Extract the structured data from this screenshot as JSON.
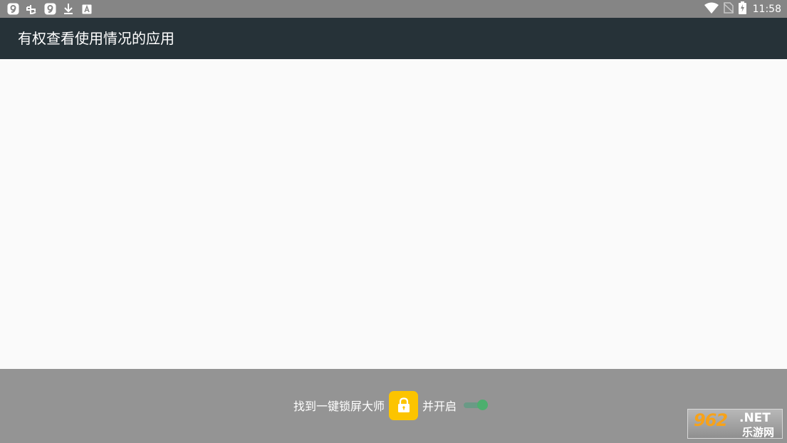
{
  "status_bar": {
    "left_icons": [
      "app-notification-icon",
      "bug-icon",
      "app-notification-icon",
      "download-icon",
      "text-a-icon"
    ],
    "right_icons": [
      "wifi-icon",
      "no-sim-icon",
      "battery-charging-icon"
    ],
    "time": "11:58"
  },
  "app_bar": {
    "title": "有权查看使用情况的应用"
  },
  "guide": {
    "text_before": "找到一键锁屏大师",
    "app_icon": "lock-icon",
    "app_icon_color": "#fcc400",
    "text_after": "并开启",
    "toggle_state": "on"
  },
  "watermark": {
    "number": "962",
    "domain": ".NET",
    "site_name": "乐游网"
  },
  "colors": {
    "status_bar": "#858585",
    "app_bar": "#263238",
    "content": "#fafafa",
    "guide_bar": "#949494",
    "toggle_on": "#4caf6e"
  }
}
